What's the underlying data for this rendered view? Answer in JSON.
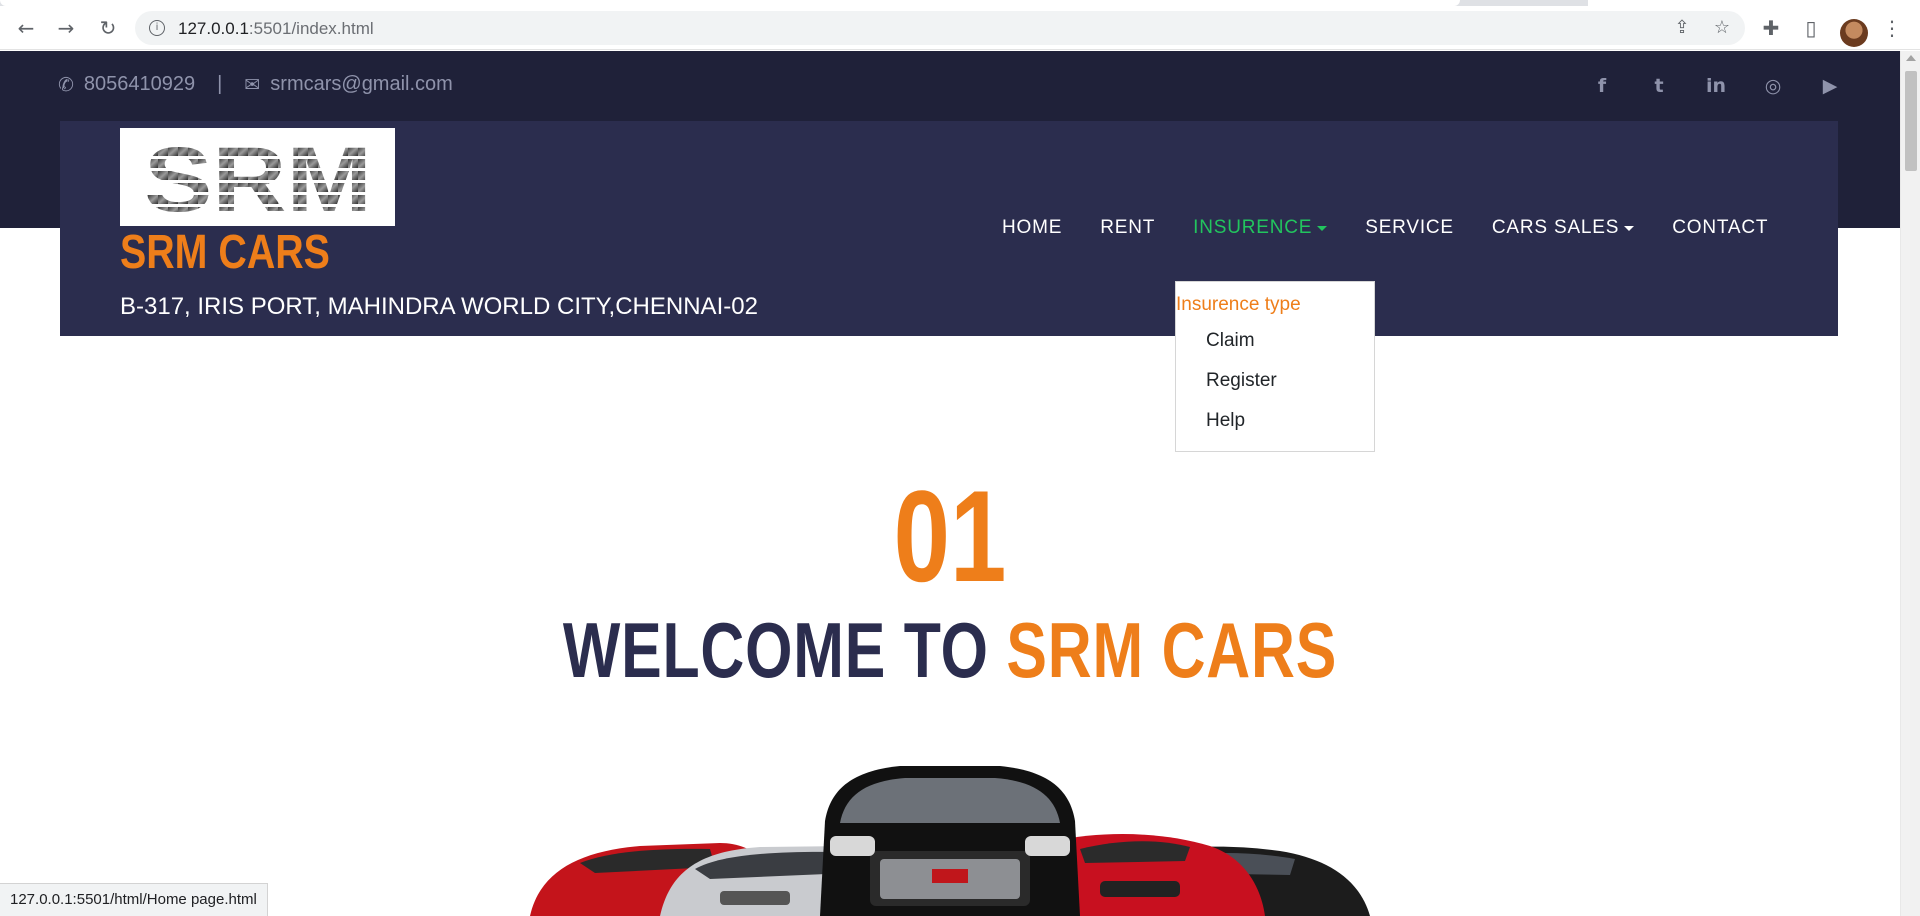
{
  "browser": {
    "url_host": "127.0.0.1",
    "url_rest": ":5501/index.html",
    "back_icon": "←",
    "forward_icon": "→",
    "reload_icon": "↻",
    "share_icon": "⇪",
    "star_icon": "☆",
    "extensions_icon": "✚",
    "sidepanel_icon": "▯",
    "menu_icon": "⋮",
    "status_url": "127.0.0.1:5501/html/Home page.html"
  },
  "topbar": {
    "phone": "8056410929",
    "separator": "|",
    "email": "srmcars@gmail.com",
    "phone_icon": "✆",
    "mail_icon": "✉",
    "socials": [
      "f",
      "t",
      "in",
      "◎",
      "▶"
    ]
  },
  "header": {
    "logo_text": "SRM",
    "brand": "SRM CARS",
    "address": "B-317, IRIS PORT, MAHINDRA WORLD CITY,CHENNAI-02"
  },
  "nav": {
    "items": [
      {
        "label": "HOME"
      },
      {
        "label": "RENT"
      },
      {
        "label": "INSURENCE"
      },
      {
        "label": "SERVICE"
      },
      {
        "label": "CARS SALES"
      },
      {
        "label": "CONTACT"
      }
    ]
  },
  "dropdown": {
    "header": "Insurence type",
    "options": [
      "Claim",
      "Register",
      "Help"
    ]
  },
  "hero": {
    "counter": "01",
    "welcome_prefix": "WELCOME TO ",
    "welcome_accent": "SRM CARS"
  },
  "colors": {
    "orange": "#ee7e1a",
    "navy": "#2b2d4e",
    "dark_band": "#1f2139",
    "active_green": "#22c55e"
  }
}
